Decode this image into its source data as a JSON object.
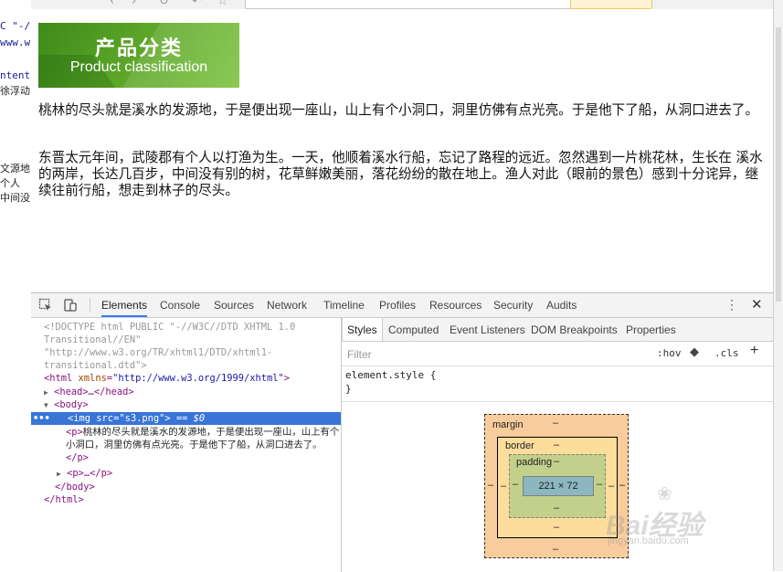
{
  "background_left": {
    "fragments": [
      "C \"-/",
      "www.w",
      "ntent",
      "徐浮动",
      "文源地",
      "个人",
      "中间没"
    ]
  },
  "page": {
    "banner": {
      "title_cn": "产品分类",
      "title_en": "Product classification"
    },
    "paragraph1": "桃林的尽头就是溪水的发源地，于是便出现一座山，山上有个小洞口，洞里仿佛有点光亮。于是他下了船，从洞口进去了。",
    "paragraph2": "东晋太元年间，武陵郡有个人以打渔为生。一天，他顺着溪水行船，忘记了路程的远近。忽然遇到一片桃花林，生长在 溪水的两岸，长达几百步，中间没有别的树，花草鲜嫩美丽，落花纷纷的散在地上。渔人对此（眼前的景色）感到十分诧异，继续往前行船，想走到林子的尽头。"
  },
  "devtools": {
    "tabs": [
      "Elements",
      "Console",
      "Sources",
      "Network",
      "Timeline",
      "Profiles",
      "Resources",
      "Security",
      "Audits"
    ],
    "active_tab": "Elements",
    "elements": {
      "doctype_1": "<!DOCTYPE html PUBLIC \"-//W3C//DTD XHTML 1.0",
      "doctype_2": "Transitional//EN\"",
      "doctype_3": "\"http://www.w3.org/TR/xhtml1/DTD/xhtml1-",
      "doctype_4": "transitional.dtd\">",
      "html_open": "<html",
      "html_attr": "xmlns",
      "html_val": "\"http://www.w3.org/1999/xhtml\"",
      "head": "<head>…</head>",
      "body_open": "<body>",
      "img_tag": "<img",
      "img_attr": "src",
      "img_val": "\"s3.png\"",
      "img_suffix": "> == $0",
      "p_open": "<p>",
      "p_text": "桃林的尽头就是溪水的发源地，于是便出现一座山，山上有个小洞口，洞里仿佛有点光亮。于是他下了船，从洞口进去了。",
      "p_close": "</p>",
      "p_collapsed": "<p>…</p>",
      "body_close": "</body>",
      "html_close": "</html>",
      "selected_marker": "•••"
    },
    "styles": {
      "subtabs": [
        "Styles",
        "Computed",
        "Event Listeners",
        "DOM Breakpoints",
        "Properties"
      ],
      "active_subtab": "Styles",
      "filter_placeholder": "Filter",
      "hov": ":hov",
      "cls": ".cls",
      "plus": "+",
      "rule_selector": "element.style {",
      "rule_close": "}"
    },
    "box_model": {
      "margin_label": "margin",
      "border_label": "border",
      "padding_label": "padding",
      "dash": "–",
      "content_size": "221 × 72"
    }
  },
  "watermark": {
    "text": "Bai经验",
    "sub": "jingyan.baidu.com"
  },
  "colors": {
    "selection": "#3875d7",
    "banner_green": "#5aa428",
    "margin_box": "#f9cc9d",
    "border_box": "#fddd9b",
    "padding_box": "#c3d08b",
    "content_box": "#8cb6c0"
  }
}
